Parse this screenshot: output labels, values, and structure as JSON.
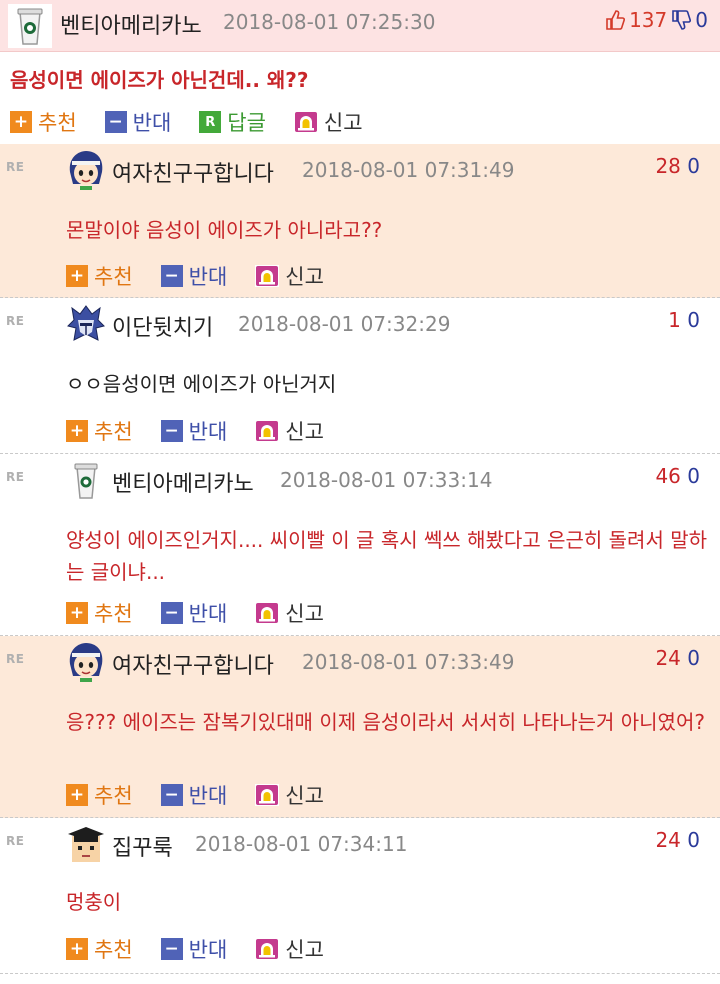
{
  "post": {
    "author": "벤티아메리카노",
    "date": "2018-08-01 07:25:30",
    "upvotes": "137",
    "downvotes": "0",
    "title": "음성이면 에이즈가 아닌건데.. 왜??",
    "actions": {
      "recommend": "추천",
      "oppose": "반대",
      "reply": "답글",
      "report": "신고"
    },
    "reply_icon_letter": "R"
  },
  "re_label": "RE",
  "comments": [
    {
      "author": "여자친구구합니다",
      "date": "2018-08-01 07:31:49",
      "up": "28",
      "down": "0",
      "text": "몬말이야 음성이 에이즈가 아니라고??",
      "avatar": "girl-avatar-icon"
    },
    {
      "author": "이단뒷치기",
      "date": "2018-08-01 07:32:29",
      "up": "1",
      "down": "0",
      "text": "ㅇㅇ음성이면 에이즈가 아닌거지",
      "avatar": "knight-helmet-avatar-icon"
    },
    {
      "author": "벤티아메리카노",
      "date": "2018-08-01 07:33:14",
      "up": "46",
      "down": "0",
      "text": "양성이 에이즈인거지.... 씨이빨 이 글 혹시 쎅쓰 해봤다고 은근히 돌려서 말하는 글이냐...",
      "avatar": "coffee-cup-avatar-icon"
    },
    {
      "author": "여자친구구합니다",
      "date": "2018-08-01 07:33:49",
      "up": "24",
      "down": "0",
      "text": "응??? 에이즈는 잠복기있대매 이제 음성이라서 서서히 나타나는거 아니였어?",
      "avatar": "girl-avatar-icon"
    },
    {
      "author": "집꾸룩",
      "date": "2018-08-01 07:34:11",
      "up": "24",
      "down": "0",
      "text": "멍충이",
      "avatar": "graduate-avatar-icon"
    }
  ],
  "comment_actions": {
    "recommend": "추천",
    "oppose": "반대",
    "report": "신고"
  },
  "colors": {
    "header_bg": "#fde3e3",
    "highlight_bg": "#fde9d9",
    "red_text": "#c8262a",
    "score_blue": "#2a3a9a"
  }
}
